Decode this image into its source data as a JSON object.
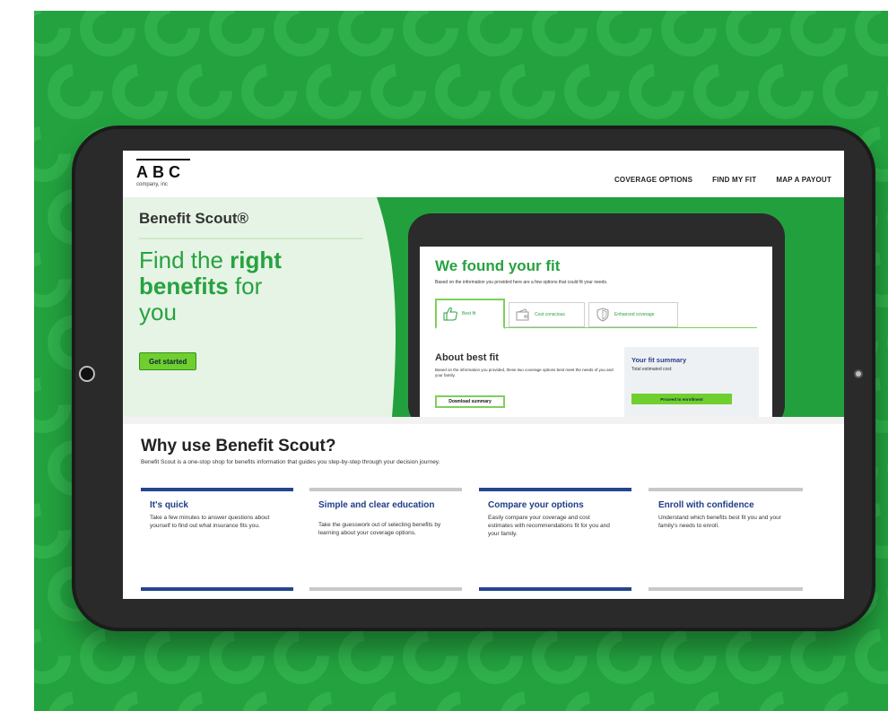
{
  "nav": {
    "logo": "ABC",
    "logo_sub": "company, inc",
    "links": [
      "COVERAGE OPTIONS",
      "FIND MY FIT",
      "MAP A PAYOUT"
    ]
  },
  "hero": {
    "brand": "Benefit Scout®",
    "headline": [
      "Find the ",
      "right",
      " ",
      "benefits",
      " for",
      "you"
    ],
    "cta": "Get started"
  },
  "fit_screen": {
    "title": "We found your fit",
    "subtitle": "Based on the information you provided here are a few options that could fit your needs.",
    "tabs": [
      "Best fit",
      "Cost conscious",
      "Enhanced coverage"
    ],
    "about_title": "About best fit",
    "about_text": "Based on the information you provided, these two coverage options best meet the needs of you and your family.",
    "download": "Download summary",
    "summary_title": "Your fit summary",
    "summary_text": "Total estimated cost:",
    "proceed": "Proceed to enrollment"
  },
  "why": {
    "title": "Why use Benefit Scout?",
    "subtitle": "Benefit Scout is a one-stop shop for benefits information that guides you step-by-step through your decision journey.",
    "columns": [
      {
        "title": "It's quick",
        "text": "Take a few minutes to answer questions about yourself to find out what insurance fits you.",
        "bar_color": "#24468f"
      },
      {
        "title": "Simple and clear education",
        "text": "Take the guesswork out of selecting benefits by learning about your coverage options.",
        "bar_color": "#c8c8c8"
      },
      {
        "title": "Compare your options",
        "text": "Easily compare your coverage and cost estimates with recommendations fit for you and your family.",
        "bar_color": "#24468f"
      },
      {
        "title": "Enroll with confidence",
        "text": "Understand which benefits best fit you and your family's needs to enroll.",
        "bar_color": "#c8c8c8"
      }
    ]
  },
  "colors": {
    "background_green": "#23a23f",
    "accent_green": "#6fcf2f",
    "navy": "#24468f"
  }
}
